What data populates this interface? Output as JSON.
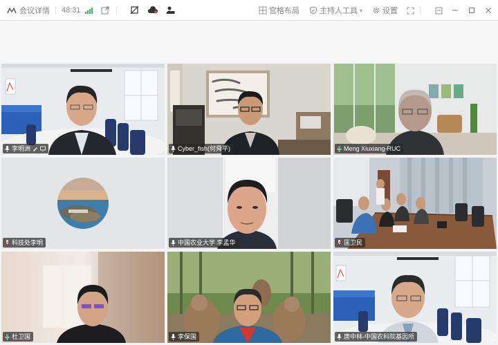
{
  "titlebar": {
    "meeting_details": "会议详情",
    "duration": "48:31",
    "layout_label": "宫格布局",
    "host_tools_label": "主持人工具",
    "settings_label": "设置"
  },
  "participants": [
    {
      "name": "李明洲"
    },
    {
      "name": "Cyber_fish(何舜平)"
    },
    {
      "name": "Meng Xiuxiang-RUC"
    },
    {
      "name": "科技处李明"
    },
    {
      "name": "中国农业大学 李孟华"
    },
    {
      "name": "匡卫民"
    },
    {
      "name": "杜卫国"
    },
    {
      "name": "李保国"
    },
    {
      "name": "唐中林-中国农科院基因所"
    }
  ],
  "colors": {
    "active_speaker_border": "#35c27a",
    "signal_green": "#3bb36b"
  }
}
